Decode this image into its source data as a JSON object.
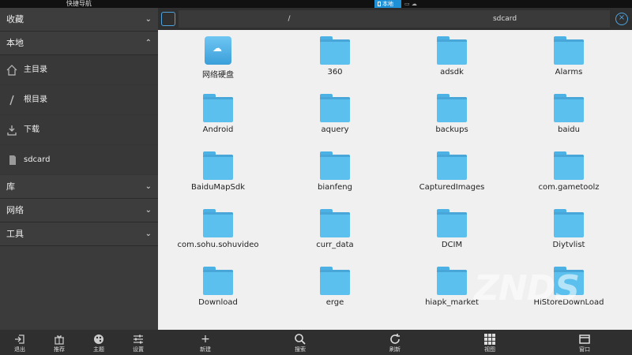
{
  "statusbar": {
    "nav_title": "快捷导航",
    "local_label": "本地"
  },
  "sidebar": {
    "sections": [
      {
        "label": "收藏",
        "chevron": "﹀"
      },
      {
        "label": "本地",
        "chevron": "︿"
      }
    ],
    "local_items": [
      {
        "label": "主目录",
        "icon": "home-icon"
      },
      {
        "label": "根目录",
        "icon": "slash-icon"
      },
      {
        "label": "下载",
        "icon": "download-icon"
      },
      {
        "label": "sdcard",
        "icon": "sdcard-icon"
      }
    ],
    "more_sections": [
      {
        "label": "库",
        "chevron": "﹀"
      },
      {
        "label": "网络",
        "chevron": "﹀"
      },
      {
        "label": "工具",
        "chevron": "﹀"
      }
    ],
    "bottom_buttons": [
      {
        "label": "退出",
        "icon": "exit-icon"
      },
      {
        "label": "推荐",
        "icon": "gift-icon"
      },
      {
        "label": "主题",
        "icon": "palette-icon"
      },
      {
        "label": "设置",
        "icon": "settings-sliders-icon"
      }
    ]
  },
  "pathbar": {
    "root": "/",
    "current": "sdcard"
  },
  "files": [
    {
      "name": "网络硬盘",
      "type": "drive"
    },
    {
      "name": "360",
      "type": "folder"
    },
    {
      "name": "adsdk",
      "type": "folder"
    },
    {
      "name": "Alarms",
      "type": "folder"
    },
    {
      "name": "Android",
      "type": "folder"
    },
    {
      "name": "aquery",
      "type": "folder"
    },
    {
      "name": "backups",
      "type": "folder"
    },
    {
      "name": "baidu",
      "type": "folder"
    },
    {
      "name": "BaiduMapSdk",
      "type": "folder"
    },
    {
      "name": "bianfeng",
      "type": "folder"
    },
    {
      "name": "CapturedImages",
      "type": "folder"
    },
    {
      "name": "com.gametoolz",
      "type": "folder"
    },
    {
      "name": "com.sohu.sohuvideo",
      "type": "folder"
    },
    {
      "name": "curr_data",
      "type": "folder"
    },
    {
      "name": "DCIM",
      "type": "folder"
    },
    {
      "name": "Diytvlist",
      "type": "folder"
    },
    {
      "name": "Download",
      "type": "folder"
    },
    {
      "name": "erge",
      "type": "folder"
    },
    {
      "name": "hiapk_market",
      "type": "folder"
    },
    {
      "name": "HiStoreDownLoad",
      "type": "folder"
    }
  ],
  "bottombar": [
    {
      "label": "新建",
      "icon": "plus-icon"
    },
    {
      "label": "搜索",
      "icon": "search-icon"
    },
    {
      "label": "刷新",
      "icon": "refresh-icon"
    },
    {
      "label": "视图",
      "icon": "grid-view-icon"
    },
    {
      "label": "窗口",
      "icon": "window-icon"
    }
  ],
  "watermark": "ZNDS"
}
